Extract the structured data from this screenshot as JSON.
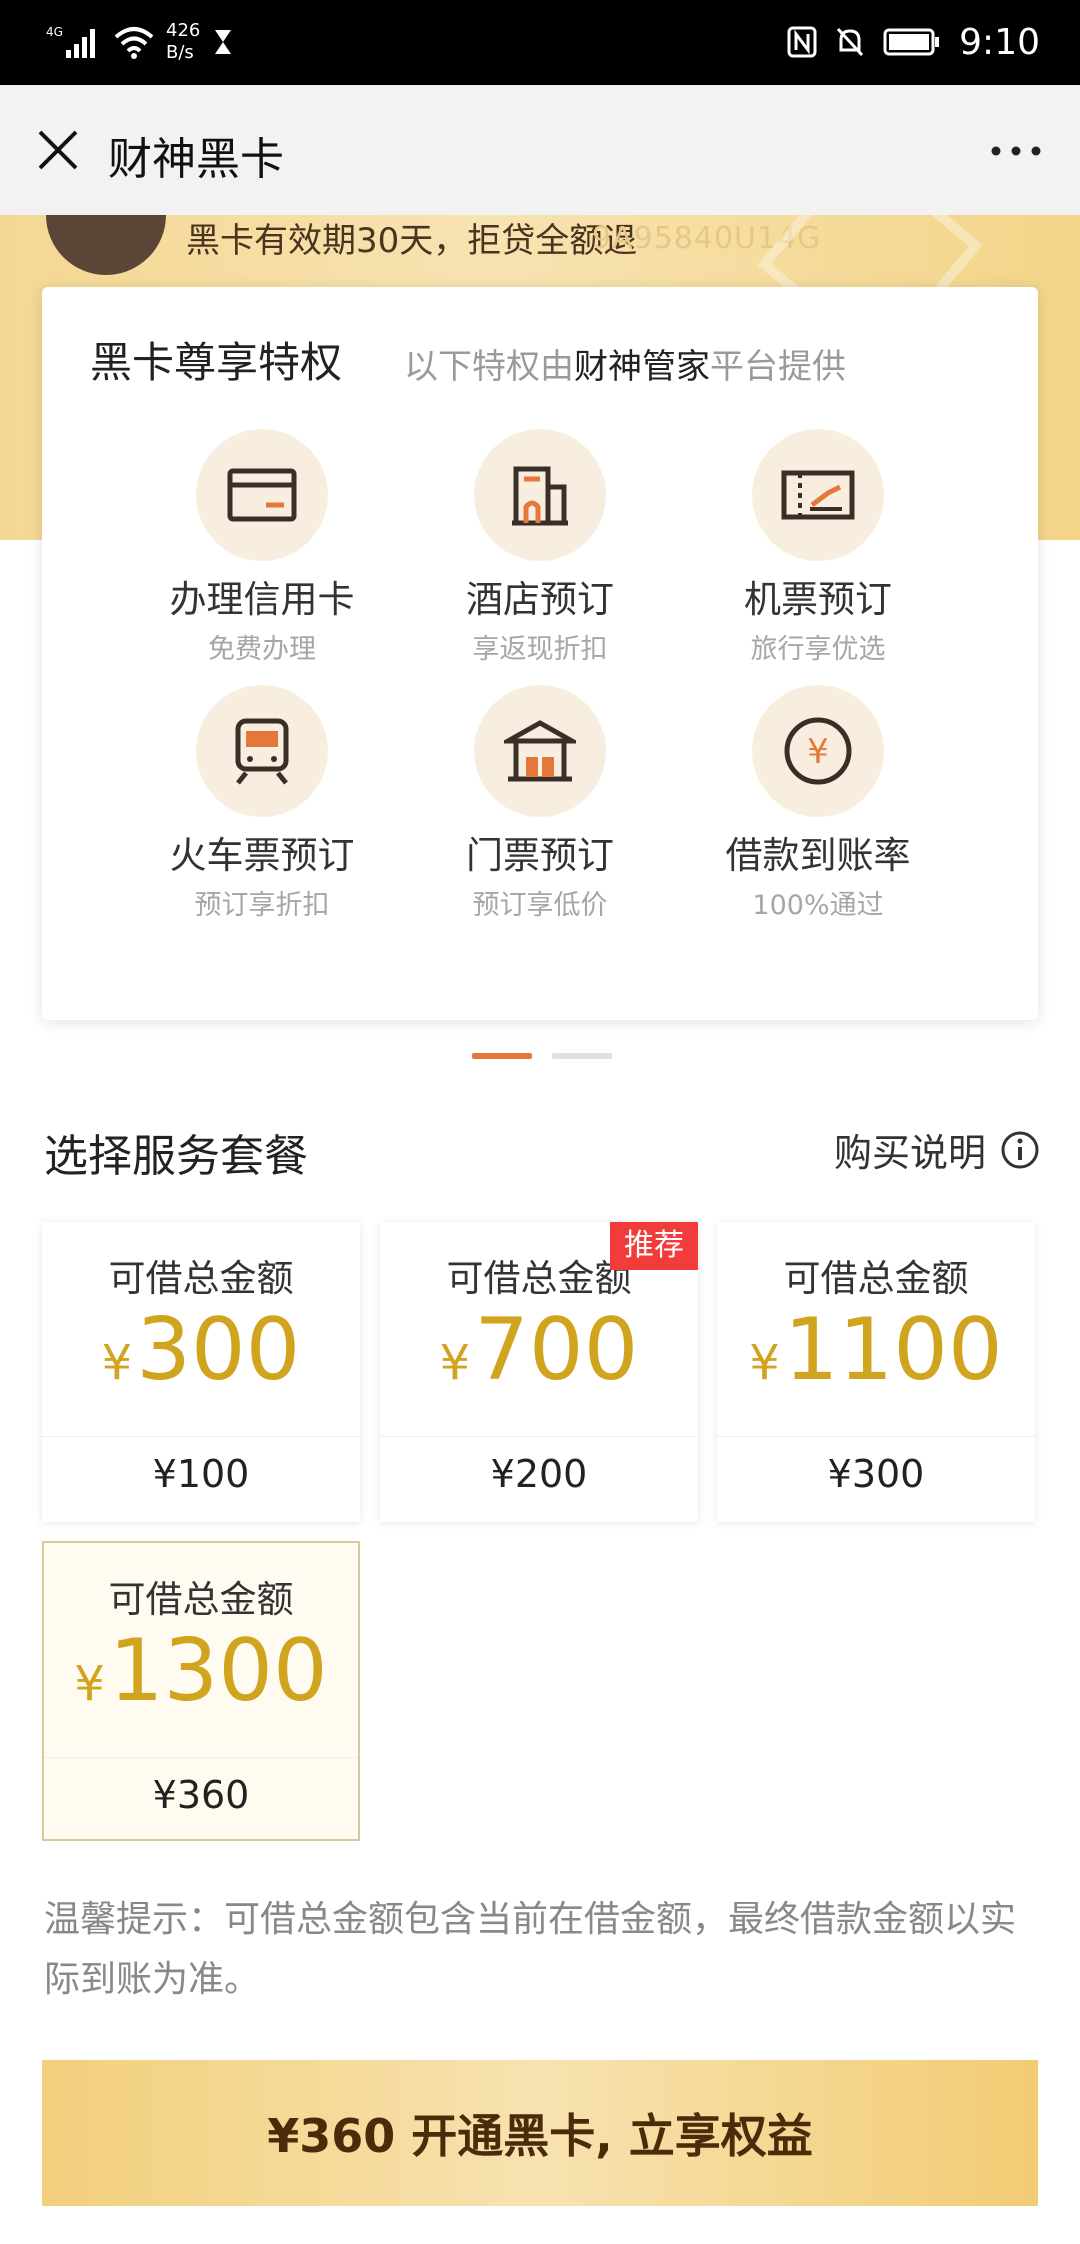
{
  "status_bar": {
    "network": "4G",
    "speed_value": "426",
    "speed_unit": "B/s",
    "time": "9:10"
  },
  "header": {
    "title": "财神黑卡"
  },
  "banner": {
    "text": "黑卡有效期30天，拒贷全额退",
    "code": "9A95840U14G"
  },
  "privileges": {
    "title": "黑卡尊享特权",
    "subtitle_prefix": "以下特权由",
    "subtitle_highlight": "财神管家",
    "subtitle_suffix": "平台提供",
    "items": [
      {
        "icon": "credit-card-icon",
        "name": "办理信用卡",
        "desc": "免费办理"
      },
      {
        "icon": "hotel-icon",
        "name": "酒店预订",
        "desc": "享返现折扣"
      },
      {
        "icon": "flight-ticket-icon",
        "name": "机票预订",
        "desc": "旅行享优选"
      },
      {
        "icon": "train-icon",
        "name": "火车票预订",
        "desc": "预订享折扣"
      },
      {
        "icon": "attraction-gate-icon",
        "name": "门票预订",
        "desc": "预订享低价"
      },
      {
        "icon": "yuan-coin-icon",
        "name": "借款到账率",
        "desc": "100%通过"
      }
    ]
  },
  "pager": {
    "total": 2,
    "active": 1
  },
  "packages": {
    "title": "选择服务套餐",
    "purchase_info": "购买说明",
    "currency": "¥",
    "badge": "推荐",
    "items": [
      {
        "label": "可借总金额",
        "amount": "300",
        "price": "¥100",
        "recommended": false,
        "selected": false
      },
      {
        "label": "可借总金额",
        "amount": "700",
        "price": "¥200",
        "recommended": true,
        "selected": false
      },
      {
        "label": "可借总金额",
        "amount": "1100",
        "price": "¥300",
        "recommended": false,
        "selected": false
      },
      {
        "label": "可借总金额",
        "amount": "1300",
        "price": "¥360",
        "recommended": false,
        "selected": true
      }
    ]
  },
  "tip": "温馨提示：可借总金额包含当前在借金额，最终借款金额以实际到账为准。",
  "cta": {
    "label": "¥360 开通黑卡, 立享权益"
  },
  "colors": {
    "gold": "#d1a41f",
    "badge_red": "#f23b3b",
    "pager_active": "#e5773b",
    "icon_orange": "#e5773b",
    "icon_dark": "#3a2f27"
  }
}
